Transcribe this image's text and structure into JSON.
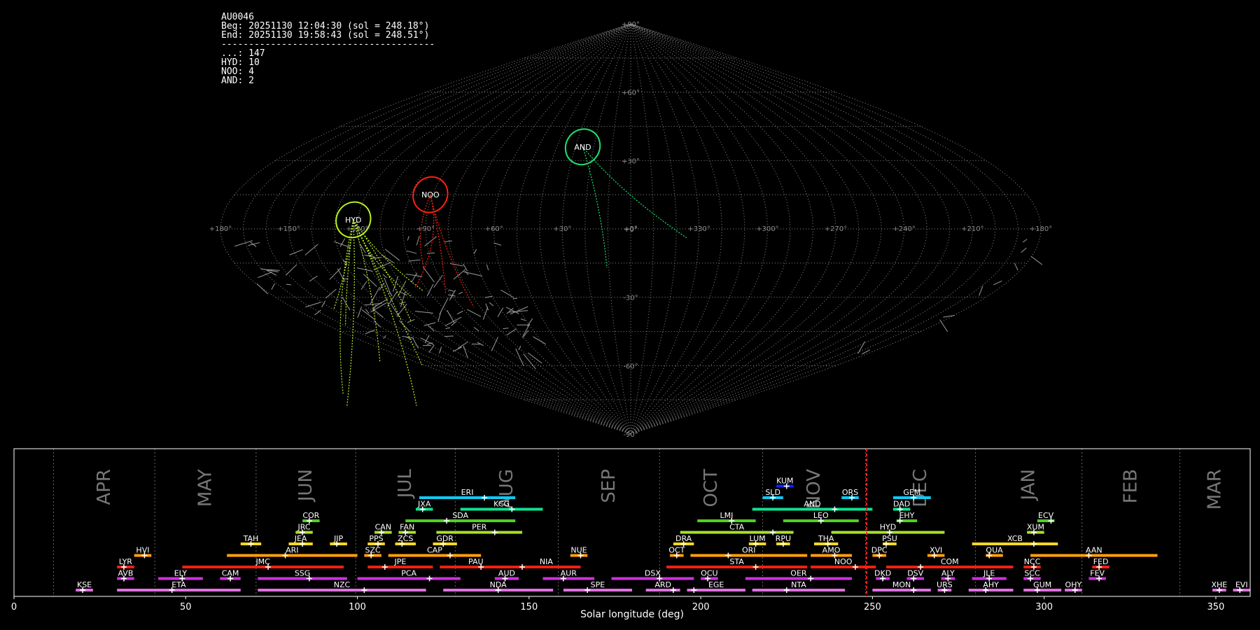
{
  "header": {
    "station": "AU0046",
    "beg": "Beg: 20251130 12:04:30 (sol = 248.18°)",
    "end": "End: 20251130 19:58:43 (sol = 248.51°)",
    "divider": "---------------------------------------",
    "counts": [
      "...: 147",
      "HYD: 10",
      "NOO: 4",
      "AND: 2"
    ]
  },
  "colors": {
    "background": "#000000",
    "grid": "#8c8c8c",
    "sporadic": "#9a9a9a",
    "now_line": "#ff2020",
    "HYD": "#b8f020",
    "NOO": "#ff2010",
    "AND": "#20e070"
  },
  "chart_data": [
    {
      "type": "scatter",
      "projection": "sinusoidal",
      "x_ticks": [
        "+180°",
        "+150°",
        "+120°",
        "+90°",
        "+60°",
        "+30°",
        "+0°",
        "+330°",
        "+300°",
        "+270°",
        "+240°",
        "+210°",
        "+180°"
      ],
      "y_ticks": [
        "+90°",
        "+60°",
        "+30°",
        "+0°",
        "-30°",
        "-60°",
        "-90°"
      ],
      "radiants": [
        {
          "name": "HYD",
          "x": 122,
          "y": 4
        },
        {
          "name": "NOO",
          "x": 91,
          "y": 15
        },
        {
          "name": "AND",
          "x": 26,
          "y": 36
        }
      ]
    },
    {
      "type": "timeline",
      "xlabel": "Solar longitude (deg)",
      "xlim": [
        0,
        360
      ],
      "x_ticks": [
        0,
        50,
        100,
        150,
        200,
        250,
        300,
        350
      ],
      "current_sol": 248.3,
      "months": [
        {
          "label": "APR",
          "start": 11.5
        },
        {
          "label": "MAY",
          "start": 41
        },
        {
          "label": "JUN",
          "start": 70.5
        },
        {
          "label": "JUL",
          "start": 99.5
        },
        {
          "label": "AUG",
          "start": 128.5
        },
        {
          "label": "SEP",
          "start": 158.5
        },
        {
          "label": "OCT",
          "start": 188
        },
        {
          "label": "NOV",
          "start": 218
        },
        {
          "label": "DEC",
          "start": 248
        },
        {
          "label": "JAN",
          "start": 280
        },
        {
          "label": "FEB",
          "start": 311
        },
        {
          "label": "MAR",
          "start": 339.5
        },
        {
          "label": "",
          "start": 360
        }
      ],
      "showers": [
        {
          "name": "KUM",
          "start": 222,
          "end": 227,
          "peak": 225,
          "row": 10,
          "color": "#1020ff"
        },
        {
          "name": "ERI",
          "start": 118,
          "end": 146,
          "peak": 137,
          "row": 9,
          "color": "#10c8f0"
        },
        {
          "name": "SLD",
          "start": 218,
          "end": 224,
          "peak": 221,
          "row": 9,
          "color": "#10c8f0"
        },
        {
          "name": "ORS",
          "start": 241,
          "end": 246,
          "peak": 244,
          "row": 9,
          "color": "#10c8f0"
        },
        {
          "name": "GEM",
          "start": 256,
          "end": 267,
          "peak": 262,
          "row": 9,
          "color": "#10c8f0"
        },
        {
          "name": "JXA",
          "start": 117,
          "end": 122,
          "peak": 119,
          "row": 8,
          "color": "#10e090"
        },
        {
          "name": "KCG",
          "start": 130,
          "end": 154,
          "peak": 145,
          "row": 8,
          "color": "#10e090"
        },
        {
          "name": "AND",
          "start": 215,
          "end": 250,
          "peak": 239,
          "row": 8,
          "color": "#10e090"
        },
        {
          "name": "DAD",
          "start": 256,
          "end": 261,
          "peak": 258,
          "row": 8,
          "color": "#10e090"
        },
        {
          "name": "COR",
          "start": 84,
          "end": 89,
          "peak": 86,
          "row": 7,
          "color": "#50d020"
        },
        {
          "name": "SDA",
          "start": 114,
          "end": 146,
          "peak": 126,
          "row": 7,
          "color": "#50d020"
        },
        {
          "name": "LMI",
          "start": 199,
          "end": 216,
          "peak": 209,
          "row": 7,
          "color": "#50d020"
        },
        {
          "name": "LEO",
          "start": 224,
          "end": 246,
          "peak": 235,
          "row": 7,
          "color": "#50d020"
        },
        {
          "name": "EHY",
          "start": 257,
          "end": 263,
          "peak": 258,
          "row": 7,
          "color": "#50d020"
        },
        {
          "name": "ECV",
          "start": 298,
          "end": 303,
          "peak": 302,
          "row": 7,
          "color": "#50d020"
        },
        {
          "name": "JRC",
          "start": 82,
          "end": 87,
          "peak": 84,
          "row": 6,
          "color": "#a8e028"
        },
        {
          "name": "CAN",
          "start": 105,
          "end": 110,
          "peak": 107,
          "row": 6,
          "color": "#a8e028"
        },
        {
          "name": "FAN",
          "start": 112,
          "end": 117,
          "peak": 114,
          "row": 6,
          "color": "#a8e028"
        },
        {
          "name": "PER",
          "start": 123,
          "end": 148,
          "peak": 140,
          "row": 6,
          "color": "#a8e028"
        },
        {
          "name": "CTA",
          "start": 194,
          "end": 227,
          "peak": 221,
          "row": 6,
          "color": "#a8e028"
        },
        {
          "name": "HYD",
          "start": 238,
          "end": 271,
          "peak": 255,
          "row": 6,
          "color": "#a8e028"
        },
        {
          "name": "XUM",
          "start": 295,
          "end": 300,
          "peak": 297,
          "row": 6,
          "color": "#a8e028"
        },
        {
          "name": "TAH",
          "start": 66,
          "end": 72,
          "peak": 69,
          "row": 5,
          "color": "#ffd820"
        },
        {
          "name": "JEA",
          "start": 80,
          "end": 87,
          "peak": 84,
          "row": 5,
          "color": "#ffd820"
        },
        {
          "name": "JIP",
          "start": 92,
          "end": 97,
          "peak": 94,
          "row": 5,
          "color": "#ffd820"
        },
        {
          "name": "PPS",
          "start": 103,
          "end": 108,
          "peak": 106,
          "row": 5,
          "color": "#ffd820"
        },
        {
          "name": "ZCS",
          "start": 111,
          "end": 117,
          "peak": 113,
          "row": 5,
          "color": "#ffd820"
        },
        {
          "name": "GDR",
          "start": 122,
          "end": 129,
          "peak": 125,
          "row": 5,
          "color": "#ffd820"
        },
        {
          "name": "DRA",
          "start": 192,
          "end": 198,
          "peak": 195,
          "row": 5,
          "color": "#ffd820"
        },
        {
          "name": "LUM",
          "start": 214,
          "end": 219,
          "peak": 216,
          "row": 5,
          "color": "#ffd820"
        },
        {
          "name": "RPU",
          "start": 222,
          "end": 226,
          "peak": 224,
          "row": 5,
          "color": "#ffd820"
        },
        {
          "name": "THA",
          "start": 233,
          "end": 240,
          "peak": 237,
          "row": 5,
          "color": "#ffd820"
        },
        {
          "name": "PSU",
          "start": 253,
          "end": 257,
          "peak": 254,
          "row": 5,
          "color": "#ffd820"
        },
        {
          "name": "XCB",
          "start": 279,
          "end": 304,
          "peak": 297,
          "row": 5,
          "color": "#ffd820"
        },
        {
          "name": "HVI",
          "start": 35,
          "end": 40,
          "peak": 38,
          "row": 4,
          "color": "#ffa010"
        },
        {
          "name": "ARI",
          "start": 62,
          "end": 100,
          "peak": 79,
          "row": 4,
          "color": "#ffa010"
        },
        {
          "name": "SZC",
          "start": 102,
          "end": 107,
          "peak": 104,
          "row": 4,
          "color": "#ffa010"
        },
        {
          "name": "CAP",
          "start": 109,
          "end": 136,
          "peak": 127,
          "row": 4,
          "color": "#ffa010"
        },
        {
          "name": "NUE",
          "start": 162,
          "end": 167,
          "peak": 165,
          "row": 4,
          "color": "#ffa010"
        },
        {
          "name": "OCT",
          "start": 191,
          "end": 195,
          "peak": 193,
          "row": 4,
          "color": "#ffa010"
        },
        {
          "name": "ORI",
          "start": 197,
          "end": 231,
          "peak": 208,
          "row": 4,
          "color": "#ffa010"
        },
        {
          "name": "AMO",
          "start": 232,
          "end": 244,
          "peak": 239,
          "row": 4,
          "color": "#ffa010"
        },
        {
          "name": "DPC",
          "start": 250,
          "end": 254,
          "peak": 252,
          "row": 4,
          "color": "#ffa010"
        },
        {
          "name": "XVI",
          "start": 266,
          "end": 271,
          "peak": 268,
          "row": 4,
          "color": "#ffa010"
        },
        {
          "name": "QUA",
          "start": 283,
          "end": 288,
          "peak": 284,
          "row": 4,
          "color": "#ffa010"
        },
        {
          "name": "AAN",
          "start": 296,
          "end": 333,
          "peak": 313,
          "row": 4,
          "color": "#ffa010"
        },
        {
          "name": "LYR",
          "start": 30,
          "end": 35,
          "peak": 32,
          "row": 3,
          "color": "#f02010"
        },
        {
          "name": "JMC",
          "start": 49,
          "end": 96,
          "peak": 74,
          "row": 3,
          "color": "#f02010"
        },
        {
          "name": "JPE",
          "start": 103,
          "end": 122,
          "peak": 108,
          "row": 3,
          "color": "#f02010"
        },
        {
          "name": "PAU",
          "start": 124,
          "end": 145,
          "peak": 136,
          "row": 3,
          "color": "#f02010"
        },
        {
          "name": "NIA",
          "start": 145,
          "end": 165,
          "peak": 148,
          "row": 3,
          "color": "#f02010"
        },
        {
          "name": "STA",
          "start": 190,
          "end": 231,
          "peak": 216,
          "row": 3,
          "color": "#f02010"
        },
        {
          "name": "NOO",
          "start": 232,
          "end": 251,
          "peak": 245,
          "row": 3,
          "color": "#f02010"
        },
        {
          "name": "COM",
          "start": 254,
          "end": 291,
          "peak": 264,
          "row": 3,
          "color": "#f02010"
        },
        {
          "name": "NCC",
          "start": 294,
          "end": 299,
          "peak": 297,
          "row": 3,
          "color": "#f02010"
        },
        {
          "name": "FED",
          "start": 314,
          "end": 319,
          "peak": 316,
          "row": 3,
          "color": "#f02010"
        },
        {
          "name": "AVB",
          "start": 30,
          "end": 35,
          "peak": 32,
          "row": 2,
          "color": "#d030e0"
        },
        {
          "name": "ELY",
          "start": 42,
          "end": 55,
          "peak": 49,
          "row": 2,
          "color": "#d030e0"
        },
        {
          "name": "CAM",
          "start": 60,
          "end": 66,
          "peak": 63,
          "row": 2,
          "color": "#d030e0"
        },
        {
          "name": "SSG",
          "start": 71,
          "end": 97,
          "peak": 86,
          "row": 2,
          "color": "#d030e0"
        },
        {
          "name": "PCA",
          "start": 100,
          "end": 130,
          "peak": 121,
          "row": 2,
          "color": "#d030e0"
        },
        {
          "name": "AUD",
          "start": 140,
          "end": 147,
          "peak": 143,
          "row": 2,
          "color": "#d030e0"
        },
        {
          "name": "AUR",
          "start": 154,
          "end": 169,
          "peak": 160,
          "row": 2,
          "color": "#d030e0"
        },
        {
          "name": "DSX",
          "start": 174,
          "end": 198,
          "peak": 188,
          "row": 2,
          "color": "#d030e0"
        },
        {
          "name": "OCU",
          "start": 200,
          "end": 205,
          "peak": 202,
          "row": 2,
          "color": "#d030e0"
        },
        {
          "name": "OER",
          "start": 213,
          "end": 244,
          "peak": 232,
          "row": 2,
          "color": "#d030e0"
        },
        {
          "name": "DKD",
          "start": 251,
          "end": 255,
          "peak": 253,
          "row": 2,
          "color": "#d030e0"
        },
        {
          "name": "DSV",
          "start": 260,
          "end": 265,
          "peak": 262,
          "row": 2,
          "color": "#d030e0"
        },
        {
          "name": "ALY",
          "start": 270,
          "end": 274,
          "peak": 272,
          "row": 2,
          "color": "#d030e0"
        },
        {
          "name": "JLE",
          "start": 279,
          "end": 289,
          "peak": 284,
          "row": 2,
          "color": "#d030e0"
        },
        {
          "name": "SCC",
          "start": 294,
          "end": 299,
          "peak": 296,
          "row": 2,
          "color": "#d030e0"
        },
        {
          "name": "FEV",
          "start": 313,
          "end": 318,
          "peak": 316,
          "row": 2,
          "color": "#d030e0"
        },
        {
          "name": "KSE",
          "start": 18,
          "end": 23,
          "peak": 20,
          "row": 1,
          "color": "#e070e0"
        },
        {
          "name": "ETA",
          "start": 30,
          "end": 66,
          "peak": 46,
          "row": 1,
          "color": "#e070e0"
        },
        {
          "name": "NZC",
          "start": 71,
          "end": 120,
          "peak": 102,
          "row": 1,
          "color": "#e070e0"
        },
        {
          "name": "NDA",
          "start": 125,
          "end": 157,
          "peak": 141,
          "row": 1,
          "color": "#e070e0"
        },
        {
          "name": "SPE",
          "start": 160,
          "end": 180,
          "peak": 167,
          "row": 1,
          "color": "#e070e0"
        },
        {
          "name": "ARD",
          "start": 184,
          "end": 194,
          "peak": 192,
          "row": 1,
          "color": "#e070e0"
        },
        {
          "name": "EGE",
          "start": 196,
          "end": 213,
          "peak": 198,
          "row": 1,
          "color": "#e070e0"
        },
        {
          "name": "NTA",
          "start": 215,
          "end": 242,
          "peak": 225,
          "row": 1,
          "color": "#e070e0"
        },
        {
          "name": "MON",
          "start": 250,
          "end": 267,
          "peak": 262,
          "row": 1,
          "color": "#e070e0"
        },
        {
          "name": "URS",
          "start": 269,
          "end": 273,
          "peak": 271,
          "row": 1,
          "color": "#e070e0"
        },
        {
          "name": "AHY",
          "start": 278,
          "end": 291,
          "peak": 283,
          "row": 1,
          "color": "#e070e0"
        },
        {
          "name": "GUM",
          "start": 294,
          "end": 305,
          "peak": 298,
          "row": 1,
          "color": "#e070e0"
        },
        {
          "name": "OHY",
          "start": 306,
          "end": 311,
          "peak": 309,
          "row": 1,
          "color": "#e070e0"
        },
        {
          "name": "XHE",
          "start": 349,
          "end": 353,
          "peak": 351,
          "row": 1,
          "color": "#e070e0"
        },
        {
          "name": "EVI",
          "start": 355,
          "end": 360,
          "peak": 357,
          "row": 1,
          "color": "#e070e0"
        }
      ]
    }
  ]
}
